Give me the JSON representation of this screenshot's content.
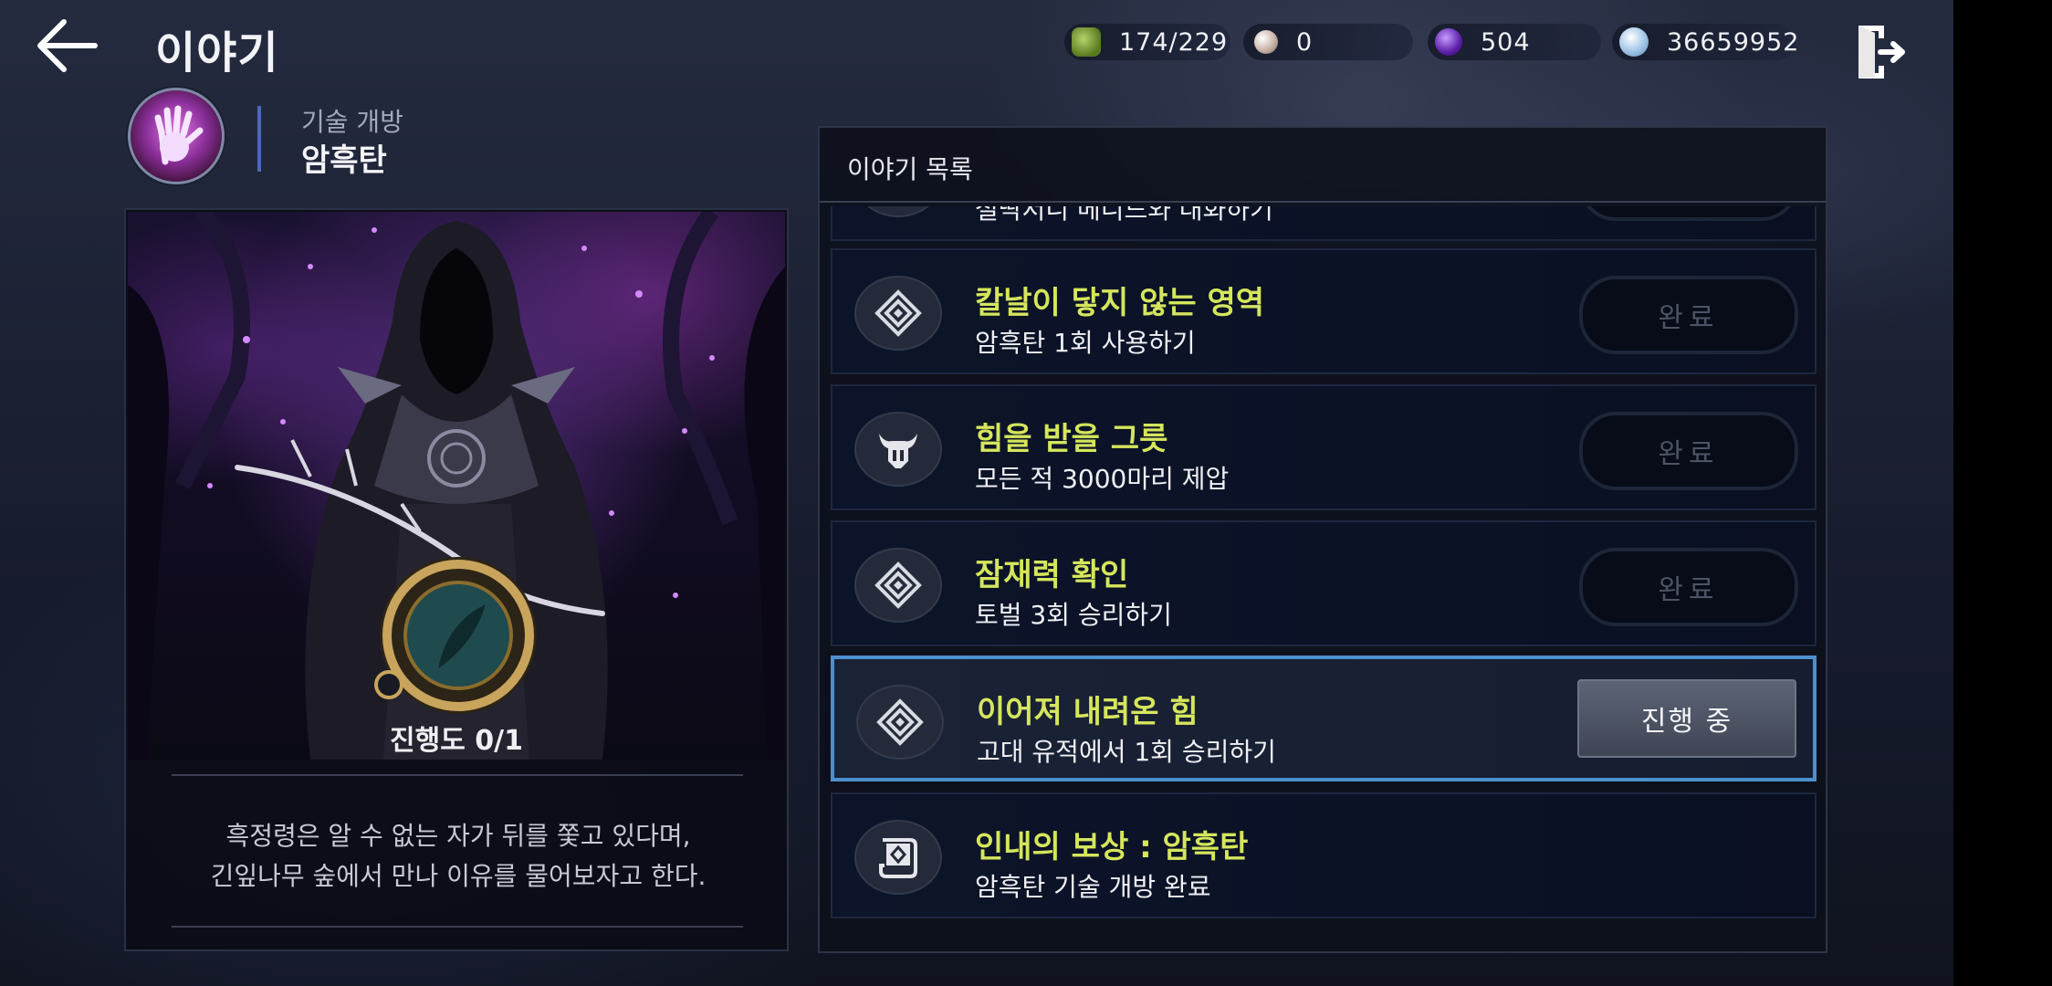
{
  "header": {
    "title": "이야기",
    "currencies": [
      {
        "icon": "stamina-icon",
        "value": "174/229"
      },
      {
        "icon": "pearl-icon",
        "value": "0"
      },
      {
        "icon": "purple-gem-icon",
        "value": "504"
      },
      {
        "icon": "silver-coin-icon",
        "value": "36659952"
      }
    ]
  },
  "skill": {
    "category": "기술 개방",
    "name": "암흑탄"
  },
  "story_card": {
    "progress": "진행도 0/1",
    "description_lines": [
      "흑정령은 알 수 없는 자가 뒤를 쫓고 있다며,",
      "긴잎나무 숲에서 만나 이유를 물어보자고 한다."
    ]
  },
  "story_list": {
    "title": "이야기 목록",
    "items": [
      {
        "title": "",
        "desc": "철딱서니 메니드와 대화하기",
        "button": "",
        "icon": "diamond-rune-icon",
        "state": "done"
      },
      {
        "title": "칼날이 닿지 않는 영역",
        "desc": "암흑탄 1회 사용하기",
        "button": "완료",
        "icon": "diamond-rune-icon",
        "state": "done"
      },
      {
        "title": "힘을 받을 그릇",
        "desc": "모든 적 3000마리 제압",
        "button": "완료",
        "icon": "horned-helmet-icon",
        "state": "done"
      },
      {
        "title": "잠재력 확인",
        "desc": "토벌 3회 승리하기",
        "button": "완료",
        "icon": "diamond-rune-icon",
        "state": "done"
      },
      {
        "title": "이어져 내려온 힘",
        "desc": "고대 유적에서 1회 승리하기",
        "button": "진행 중",
        "icon": "diamond-rune-icon",
        "state": "in-progress"
      },
      {
        "title": "인내의 보상 : 암흑탄",
        "desc": "암흑탄 기술 개방 완료",
        "button": "",
        "icon": "scroll-icon",
        "state": "reward"
      }
    ]
  },
  "colors": {
    "quest_title": "#d5e65c",
    "active_border": "#4d8fce",
    "skill_separator": "#4c69b8"
  }
}
